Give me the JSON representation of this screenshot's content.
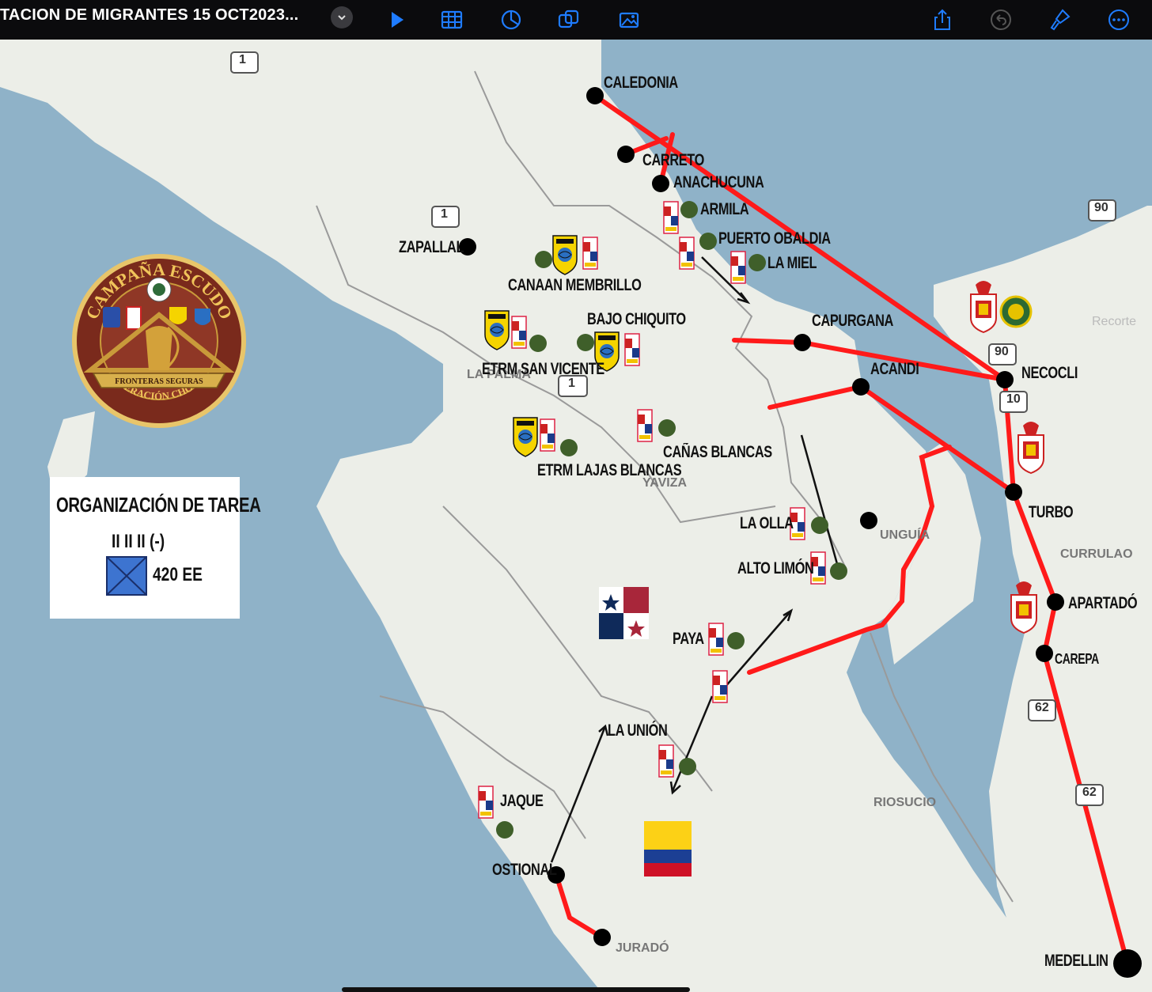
{
  "toolbar": {
    "title": "TACION DE MIGRANTES 15 OCT2023...",
    "icons": [
      "chevron-down-icon",
      "play-icon",
      "table-icon",
      "chart-icon",
      "shapes-icon",
      "media-icon",
      "share-icon",
      "undo-icon",
      "format-brush-icon",
      "more-icon"
    ]
  },
  "colors": {
    "route": "#ff1a1a",
    "sea": "#8fb2c8",
    "land": "#eceee8",
    "unit_dot": "#3f5f2a"
  },
  "seal": {
    "top_text": "CAMPAÑA ESCUDO",
    "banner_text": "FRONTERAS SEGURAS",
    "bottom_text": "OPERACIÓN CHOCÓ"
  },
  "legend": {
    "title": "ORGANIZACIÓN DE TAREA",
    "echelon": "II II II (-)",
    "count": "420 EE"
  },
  "places": {
    "caledonia": "CALEDONIA",
    "carreto": "CARRETO",
    "anachucuna": "ANACHUCUNA",
    "armila": "ARMILA",
    "puerto_obaldia": "PUERTO OBALDIA",
    "la_miel": "LA MIEL",
    "capurgana": "CAPURGANA",
    "acandi": "ACANDI",
    "necocli": "NECOCLI",
    "turbo": "TURBO",
    "apartado": "APARTADÓ",
    "carepa": "CAREPA",
    "medellin": "MEDELLIN",
    "zapallal": "ZAPALLAL",
    "canaan_membrillo": "CANAAN MEMBRILLO",
    "bajo_chiquito": "BAJO CHIQUITO",
    "etrm_san_vicente": "ETRM SAN VICENTE",
    "etrm_lajas_blancas": "ETRM LAJAS BLANCAS",
    "canas_blancas": "CAÑAS BLANCAS",
    "la_olla": "LA OLLA",
    "alto_limon": "ALTO LIMÓN",
    "paya": "PAYA",
    "la_union": "LA UNIÓN",
    "jaque": "JAQUE",
    "ostional": "OSTIONAL"
  },
  "base_map_labels": {
    "la_palma": "LA PALMA",
    "yaviza": "YAVIZA",
    "unguia": "UNGUÍA",
    "currulao": "CURRULAO",
    "riosucio": "RIOSUCIO",
    "jurado": "JURADÓ",
    "recorte": "Recorte"
  },
  "road_shields": [
    "1",
    "1",
    "1",
    "90",
    "90",
    "10",
    "62",
    "62"
  ]
}
